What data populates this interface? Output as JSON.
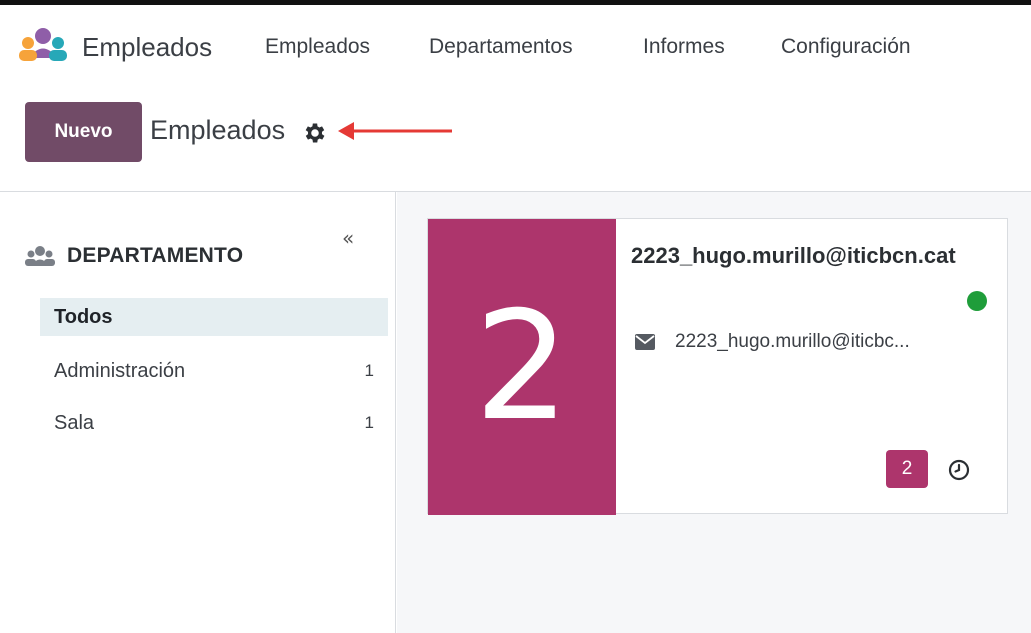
{
  "app": {
    "name": "Empleados",
    "icon": "employees-app-icon"
  },
  "nav": {
    "items": [
      "Empleados",
      "Departamentos",
      "Informes",
      "Configuración"
    ]
  },
  "control_panel": {
    "new_label": "Nuevo",
    "title": "Empleados",
    "settings_icon": "gear-icon"
  },
  "sidebar": {
    "collapse_glyph": "«",
    "section_title": "DEPARTAMENTO",
    "items": [
      {
        "label": "Todos",
        "count": "",
        "active": true
      },
      {
        "label": "Administración",
        "count": "1",
        "active": false
      },
      {
        "label": "Sala",
        "count": "1",
        "active": false
      }
    ]
  },
  "card": {
    "avatar_text": "2",
    "name": "2223_hugo.murillo@iticbcn.cat",
    "email": "2223_hugo.murillo@iticbc...",
    "status": "online",
    "badge_count": "2"
  },
  "colors": {
    "brand": "#714b67",
    "avatar": "#ad356c",
    "status_online": "#1f9d3a",
    "annotation_arrow": "#e53935",
    "active_row": "#e5eef1"
  }
}
